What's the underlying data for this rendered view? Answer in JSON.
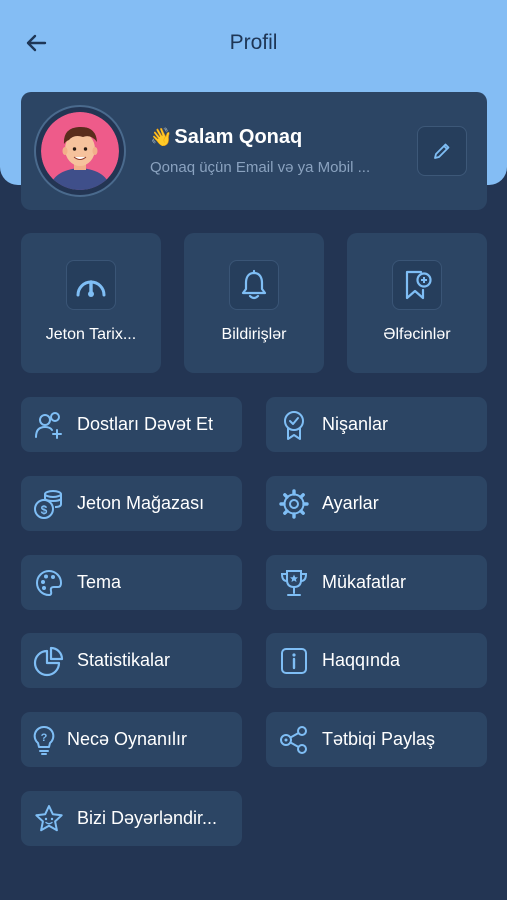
{
  "header": {
    "title": "Profil",
    "back_icon": "arrow-left-icon"
  },
  "profile": {
    "wave": "👋",
    "greeting": "Salam Qonaq",
    "subtitle": "Qonaq üçün Email və ya Mobil ...",
    "edit_icon": "pencil-icon"
  },
  "tiles": [
    {
      "label": "Jeton Tarix...",
      "icon": "gauge-icon"
    },
    {
      "label": "Bildirişlər",
      "icon": "bell-icon"
    },
    {
      "label": "Əlfəcinlər",
      "icon": "bookmark-add-icon"
    }
  ],
  "menu": [
    {
      "label": "Dostları Dəvət Et",
      "icon": "invite-friends-icon"
    },
    {
      "label": "Nişanlar",
      "icon": "badge-icon"
    },
    {
      "label": "Jeton Mağazası",
      "icon": "coins-icon"
    },
    {
      "label": "Ayarlar",
      "icon": "gear-icon"
    },
    {
      "label": "Tema",
      "icon": "palette-icon"
    },
    {
      "label": "Mükafatlar",
      "icon": "trophy-icon"
    },
    {
      "label": "Statistikalar",
      "icon": "pie-chart-icon"
    },
    {
      "label": "Haqqında",
      "icon": "info-icon"
    },
    {
      "label": "Necə Oynanılır",
      "icon": "lightbulb-icon"
    },
    {
      "label": "Tətbiqi Paylaş",
      "icon": "share-icon"
    },
    {
      "label": "Bizi Dəyərləndir...",
      "icon": "star-icon"
    }
  ],
  "colors": {
    "background": "#233553",
    "header": "#84bdf4",
    "card": "#2c4564",
    "icon": "#7fbef5"
  }
}
